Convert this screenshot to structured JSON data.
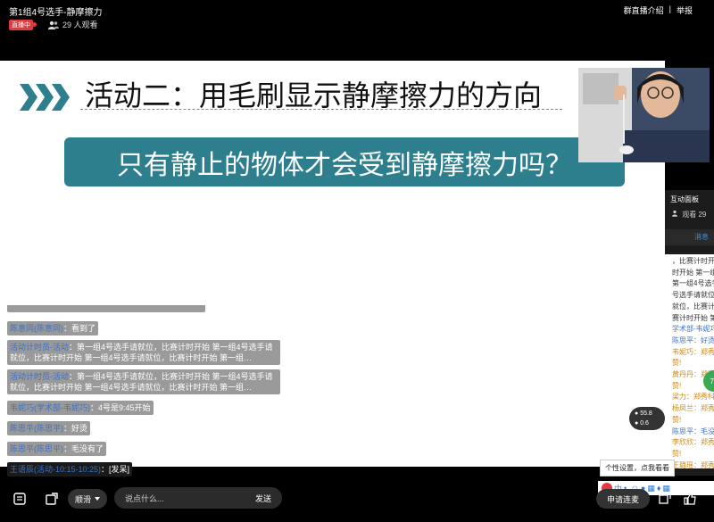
{
  "header": {
    "title": "第1组4号选手-静摩擦力",
    "live_badge": "直播中",
    "viewers": "29 人观看",
    "intro_link": "群直播介绍",
    "separator": "|",
    "report_link": "举报"
  },
  "slide": {
    "title": "活动二：用毛刷显示静摩擦力的方向",
    "banner": "只有静止的物体才会受到静摩擦力吗？"
  },
  "chat": {
    "messages": [
      {
        "nick": "陈意同(陈意同)",
        "text": "：看到了"
      },
      {
        "nick": "活动计时员-活动",
        "text": "：第一组4号选手请就位，比赛计时开始 第一组4号选手请就位，比赛计时开始 第一组4号选手请就位，比赛计时开始 第一组…"
      },
      {
        "nick": "活动计时员-活动",
        "text": "：第一组4号选手请就位，比赛计时开始 第一组4号选手请就位，比赛计时开始 第一组4号选手请就位，比赛计时开始 第一组…"
      },
      {
        "nick": "韦妮巧(学术部-韦妮巧)",
        "text": "：4号是9:45开始"
      },
      {
        "nick": "陈思平(陈思平)",
        "text": "：好烫"
      },
      {
        "nick": "陈思平(陈思平)",
        "text": "：毛没有了"
      },
      {
        "nick": "王语辰(活动-10:15-10:25)",
        "text": "：[发呆]"
      }
    ]
  },
  "panel": {
    "title": "互动面板",
    "viewers": "观看 29",
    "tab": "消息",
    "lines": [
      {
        "text": "，比赛计时开始",
        "c": ""
      },
      {
        "text": "时开始 第一组4",
        "c": ""
      },
      {
        "text": "第一组4号选手",
        "c": ""
      },
      {
        "text": "号选手请就位，",
        "c": ""
      },
      {
        "text": "就位，比赛计时",
        "c": ""
      },
      {
        "text": "赛计时开始 第一",
        "c": ""
      },
      {
        "text": "学术部-韦妮巧",
        "c": "b"
      },
      {
        "text": "陈思平：好烫",
        "c": "b"
      },
      {
        "text": "韦妮巧：郑秀",
        "c": "y"
      },
      {
        "text": "赞!",
        "c": "y"
      },
      {
        "text": "黄丹丹：郑秀",
        "c": "y"
      },
      {
        "text": "赞!",
        "c": "y"
      },
      {
        "text": "梁力：郑秀科",
        "c": "y"
      },
      {
        "text": "杨凤兰：郑秀",
        "c": "y"
      },
      {
        "text": "赞!",
        "c": "y"
      },
      {
        "text": "陈思平：毛没有",
        "c": "b"
      },
      {
        "text": "李欣欣：郑秀",
        "c": "y"
      },
      {
        "text": "赞!",
        "c": "y"
      },
      {
        "text": "王璐瑶：郑秀",
        "c": "y"
      }
    ],
    "badge": "78"
  },
  "network": {
    "up": "55.8",
    "down": "0.6"
  },
  "tooltip": "个性设置，点我看看",
  "ime": {
    "label": "中"
  },
  "bottom": {
    "filter_label": "顺滑",
    "input_placeholder": "说点什么...",
    "send_label": "发送",
    "apply_label": "申请连麦"
  },
  "colors": {
    "live": "#e0393e",
    "banner": "#2e7f8e",
    "nick": "#3a72c9",
    "mic_on": "#3caa54"
  }
}
